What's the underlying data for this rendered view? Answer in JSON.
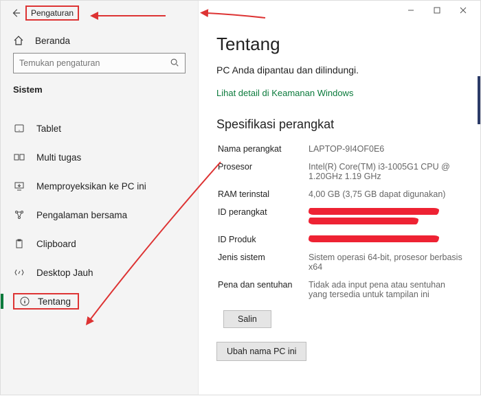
{
  "app_title": "Pengaturan",
  "home_label": "Beranda",
  "search_placeholder": "Temukan pengaturan",
  "section_label": "Sistem",
  "nav": [
    {
      "icon": "tablet",
      "label": "Tablet"
    },
    {
      "icon": "multitask",
      "label": "Multi tugas"
    },
    {
      "icon": "project",
      "label": "Memproyeksikan ke PC ini"
    },
    {
      "icon": "shared",
      "label": "Pengalaman bersama"
    },
    {
      "icon": "clipboard",
      "label": "Clipboard"
    },
    {
      "icon": "remote",
      "label": "Desktop Jauh"
    },
    {
      "icon": "about",
      "label": "Tentang"
    }
  ],
  "main": {
    "title": "Tentang",
    "protect_line": "PC Anda dipantau dan dilindungi.",
    "security_link": "Lihat detail di Keamanan Windows",
    "spec_heading": "Spesifikasi perangkat",
    "specs": {
      "device_name_k": "Nama perangkat",
      "device_name_v": "LAPTOP-9I4OF0E6",
      "processor_k": "Prosesor",
      "processor_v": "Intel(R) Core(TM) i3-1005G1 CPU @ 1.20GHz   1.19 GHz",
      "ram_k": "RAM terinstal",
      "ram_v": "4,00 GB (3,75 GB dapat digunakan)",
      "device_id_k": "ID perangkat",
      "product_id_k": "ID Produk",
      "system_type_k": "Jenis sistem",
      "system_type_v": "Sistem operasi 64-bit, prosesor berbasis x64",
      "pen_k": "Pena dan sentuhan",
      "pen_v": "Tidak ada input pena atau sentuhan yang tersedia untuk tampilan ini"
    },
    "copy_btn": "Salin",
    "rename_btn": "Ubah nama PC ini"
  }
}
